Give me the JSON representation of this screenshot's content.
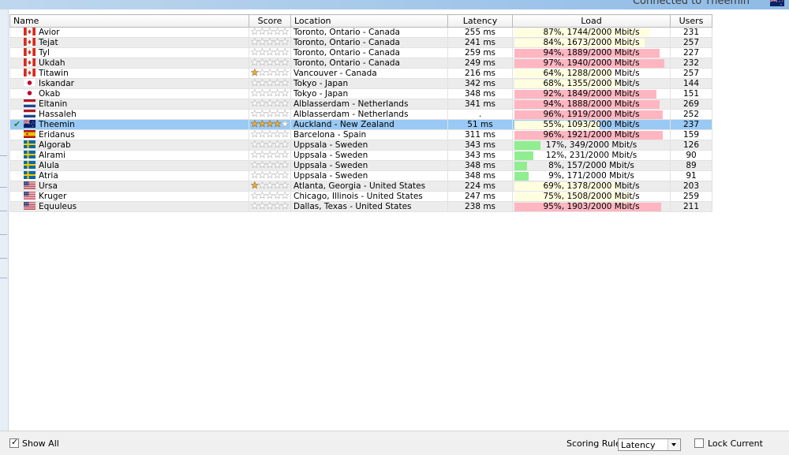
{
  "window": {
    "connection_status": "Connected to Theemin",
    "connection_flag": "new-zealand"
  },
  "table": {
    "columns": {
      "name": "Name",
      "score": "Score",
      "location": "Location",
      "latency": "Latency",
      "load": "Load",
      "users": "Users"
    },
    "rows": [
      {
        "name": "Avior",
        "flag": "canada",
        "score": 0,
        "location": "Toronto, Ontario - Canada",
        "latency": "255 ms",
        "load_pct": 0.87,
        "load_text": "87%, 1744/2000 Mbit/s",
        "load_color": "#ffffe0",
        "users": "231",
        "connected": false
      },
      {
        "name": "Tejat",
        "flag": "canada",
        "score": 0,
        "location": "Toronto, Ontario - Canada",
        "latency": "241 ms",
        "load_pct": 0.84,
        "load_text": "84%, 1673/2000 Mbit/s",
        "load_color": "#ffffe0",
        "users": "257",
        "connected": false
      },
      {
        "name": "Tyl",
        "flag": "canada",
        "score": 0,
        "location": "Toronto, Ontario - Canada",
        "latency": "259 ms",
        "load_pct": 0.94,
        "load_text": "94%, 1889/2000 Mbit/s",
        "load_color": "#ffb6c1",
        "users": "227",
        "connected": false
      },
      {
        "name": "Ukdah",
        "flag": "canada",
        "score": 0,
        "location": "Toronto, Ontario - Canada",
        "latency": "249 ms",
        "load_pct": 0.97,
        "load_text": "97%, 1940/2000 Mbit/s",
        "load_color": "#ffb6c1",
        "users": "232",
        "connected": false
      },
      {
        "name": "Titawin",
        "flag": "canada",
        "score": 1,
        "location": "Vancouver - Canada",
        "latency": "216 ms",
        "load_pct": 0.64,
        "load_text": "64%, 1288/2000 Mbit/s",
        "load_color": "#ffffe0",
        "users": "257",
        "connected": false
      },
      {
        "name": "Iskandar",
        "flag": "japan",
        "score": 0,
        "location": "Tokyo - Japan",
        "latency": "342 ms",
        "load_pct": 0.68,
        "load_text": "68%, 1355/2000 Mbit/s",
        "load_color": "#ffffe0",
        "users": "144",
        "connected": false
      },
      {
        "name": "Okab",
        "flag": "japan",
        "score": 0,
        "location": "Tokyo - Japan",
        "latency": "348 ms",
        "load_pct": 0.92,
        "load_text": "92%, 1849/2000 Mbit/s",
        "load_color": "#ffb6c1",
        "users": "151",
        "connected": false
      },
      {
        "name": "Eltanin",
        "flag": "netherlands",
        "score": 0,
        "location": "Alblasserdam - Netherlands",
        "latency": "341 ms",
        "load_pct": 0.94,
        "load_text": "94%, 1888/2000 Mbit/s",
        "load_color": "#ffb6c1",
        "users": "269",
        "connected": false
      },
      {
        "name": "Hassaleh",
        "flag": "netherlands",
        "score": 0,
        "location": "Alblasserdam - Netherlands",
        "latency": ".",
        "load_pct": 0.96,
        "load_text": "96%, 1919/2000 Mbit/s",
        "load_color": "#ffb6c1",
        "users": "252",
        "connected": false
      },
      {
        "name": "Theemin",
        "flag": "new-zealand",
        "score": 4,
        "location": "Auckland - New Zealand",
        "latency": "51 ms",
        "load_pct": 0.55,
        "load_text": "55%, 1093/2000 Mbit/s",
        "load_color": "#ffffe0",
        "users": "237",
        "connected": true
      },
      {
        "name": "Eridanus",
        "flag": "spain",
        "score": 0,
        "location": "Barcelona - Spain",
        "latency": "311 ms",
        "load_pct": 0.96,
        "load_text": "96%, 1921/2000 Mbit/s",
        "load_color": "#ffb6c1",
        "users": "159",
        "connected": false
      },
      {
        "name": "Algorab",
        "flag": "sweden",
        "score": 0,
        "location": "Uppsala - Sweden",
        "latency": "343 ms",
        "load_pct": 0.17,
        "load_text": "17%, 349/2000 Mbit/s",
        "load_color": "#90ee90",
        "users": "126",
        "connected": false
      },
      {
        "name": "Alrami",
        "flag": "sweden",
        "score": 0,
        "location": "Uppsala - Sweden",
        "latency": "343 ms",
        "load_pct": 0.12,
        "load_text": "12%, 231/2000 Mbit/s",
        "load_color": "#90ee90",
        "users": "90",
        "connected": false
      },
      {
        "name": "Alula",
        "flag": "sweden",
        "score": 0,
        "location": "Uppsala - Sweden",
        "latency": "348 ms",
        "load_pct": 0.08,
        "load_text": "8%, 157/2000 Mbit/s",
        "load_color": "#90ee90",
        "users": "89",
        "connected": false
      },
      {
        "name": "Atria",
        "flag": "sweden",
        "score": 0,
        "location": "Uppsala - Sweden",
        "latency": "348 ms",
        "load_pct": 0.09,
        "load_text": "9%, 171/2000 Mbit/s",
        "load_color": "#90ee90",
        "users": "91",
        "connected": false
      },
      {
        "name": "Ursa",
        "flag": "usa",
        "score": 1,
        "location": "Atlanta, Georgia - United States",
        "latency": "224 ms",
        "load_pct": 0.69,
        "load_text": "69%, 1378/2000 Mbit/s",
        "load_color": "#ffffe0",
        "users": "203",
        "connected": false
      },
      {
        "name": "Kruger",
        "flag": "usa",
        "score": 0,
        "location": "Chicago, Illinois - United States",
        "latency": "247 ms",
        "load_pct": 0.75,
        "load_text": "75%, 1508/2000 Mbit/s",
        "load_color": "#ffffe0",
        "users": "259",
        "connected": false
      },
      {
        "name": "Equuleus",
        "flag": "usa",
        "score": 0,
        "location": "Dallas, Texas - United States",
        "latency": "238 ms",
        "load_pct": 0.95,
        "load_text": "95%, 1903/2000 Mbit/s",
        "load_color": "#ffb6c1",
        "users": "211",
        "connected": false
      }
    ]
  },
  "footer": {
    "show_all_label": "Show All",
    "show_all_checked": true,
    "scoring_rule_label": "Scoring Rule:",
    "scoring_rule_value": "Latency",
    "lock_current_label": "Lock Current",
    "lock_current_checked": false
  }
}
